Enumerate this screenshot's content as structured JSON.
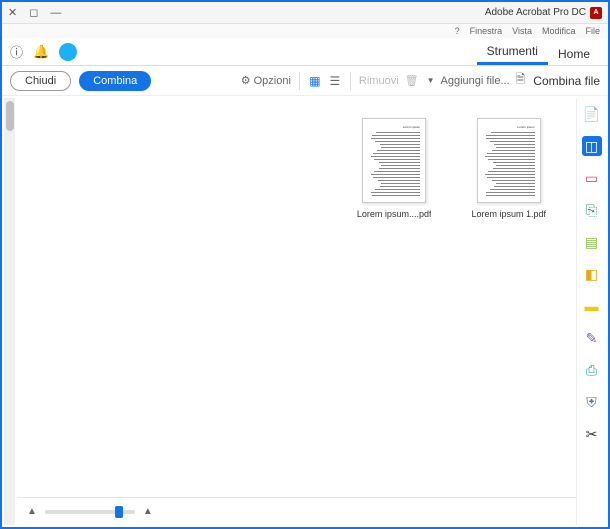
{
  "titlebar": {
    "app_name": "Adobe Acrobat Pro DC",
    "app_icon_letter": "A"
  },
  "menubar": {
    "items": [
      "File",
      "Modifica",
      "Vista",
      "Finestra",
      "?"
    ]
  },
  "tabs": {
    "home": "Home",
    "tools": "Strumenti"
  },
  "toolbar": {
    "breadcrumb": "Combina file",
    "add_file": "Aggiungi file...",
    "remove": "Rimuovi",
    "options": "Opzioni",
    "combine": "Combina",
    "close": "Chiudi"
  },
  "files": [
    {
      "label": "Lorem ipsum 1.pdf"
    },
    {
      "label": "Lorem ipsum....pdf"
    }
  ],
  "side_tools": [
    {
      "name": "create-pdf-icon",
      "glyph": "📄",
      "color": "#e8467c"
    },
    {
      "name": "combine-icon",
      "glyph": "◫",
      "color": "#fff",
      "active": true
    },
    {
      "name": "organize-icon",
      "glyph": "▭",
      "color": "#e8467c"
    },
    {
      "name": "export-icon",
      "glyph": "⎘",
      "color": "#2fa574"
    },
    {
      "name": "edit-icon",
      "glyph": "▤",
      "color": "#8bc34a"
    },
    {
      "name": "comment-icon",
      "glyph": "◧",
      "color": "#e6a817"
    },
    {
      "name": "chat-icon",
      "glyph": "▬",
      "color": "#f5c518"
    },
    {
      "name": "sign-icon",
      "glyph": "✎",
      "color": "#7e57c2"
    },
    {
      "name": "print-icon",
      "glyph": "⎙",
      "color": "#26a69a"
    },
    {
      "name": "protect-icon",
      "glyph": "⛨",
      "color": "#5c6bc0"
    },
    {
      "name": "cut-icon",
      "glyph": "✂",
      "color": "#333"
    }
  ]
}
